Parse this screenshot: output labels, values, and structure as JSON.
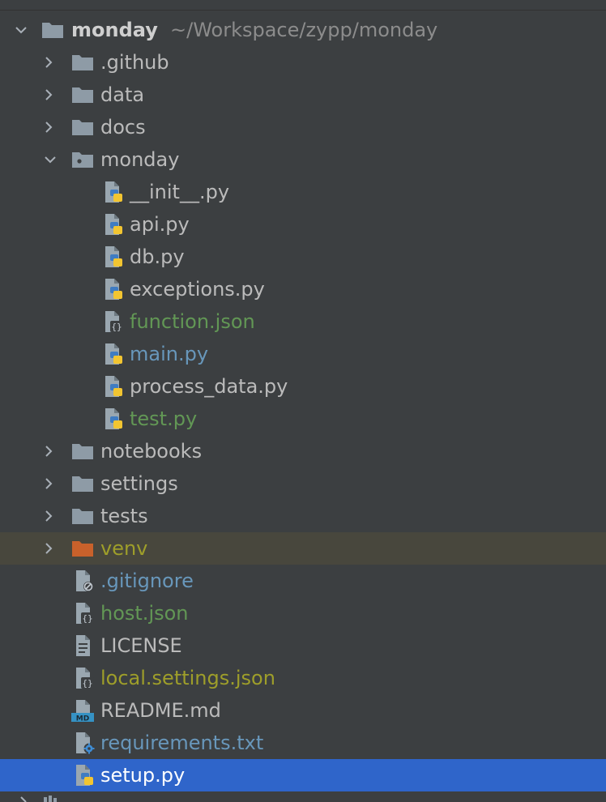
{
  "project": {
    "name": "monday",
    "path": "~/Workspace/zypp/monday"
  },
  "tree": {
    "github": ".github",
    "data": "data",
    "docs": "docs",
    "monday_pkg": "monday",
    "init_py": "__init__.py",
    "api_py": "api.py",
    "db_py": "db.py",
    "exceptions_py": "exceptions.py",
    "function_json": "function.json",
    "main_py": "main.py",
    "process_data_py": "process_data.py",
    "test_py": "test.py",
    "notebooks": "notebooks",
    "settings": "settings",
    "tests": "tests",
    "venv": "venv",
    "gitignore": ".gitignore",
    "host_json": "host.json",
    "license": "LICENSE",
    "local_settings_json": "local.settings.json",
    "readme_md": "README.md",
    "requirements_txt": "requirements.txt",
    "setup_py": "setup.py"
  },
  "icons": {
    "folder": "folder-icon",
    "package": "package-folder-icon",
    "excluded_folder": "excluded-folder-icon",
    "python": "python-file-icon",
    "json": "json-file-icon",
    "ignore": "gitignore-file-icon",
    "text": "text-file-icon",
    "markdown": "markdown-file-icon",
    "requirements": "requirements-file-icon"
  },
  "colors": {
    "background": "#3c3f41",
    "highlight_row": "#48473d",
    "selected_row": "#2f65ca",
    "text_default": "#bbbbbb",
    "text_modified_blue": "#6897bb",
    "text_new_green": "#629755",
    "text_ignored_olive": "#9e9e2a",
    "folder": "#8e9ba6",
    "excluded_folder": "#c8612b"
  }
}
